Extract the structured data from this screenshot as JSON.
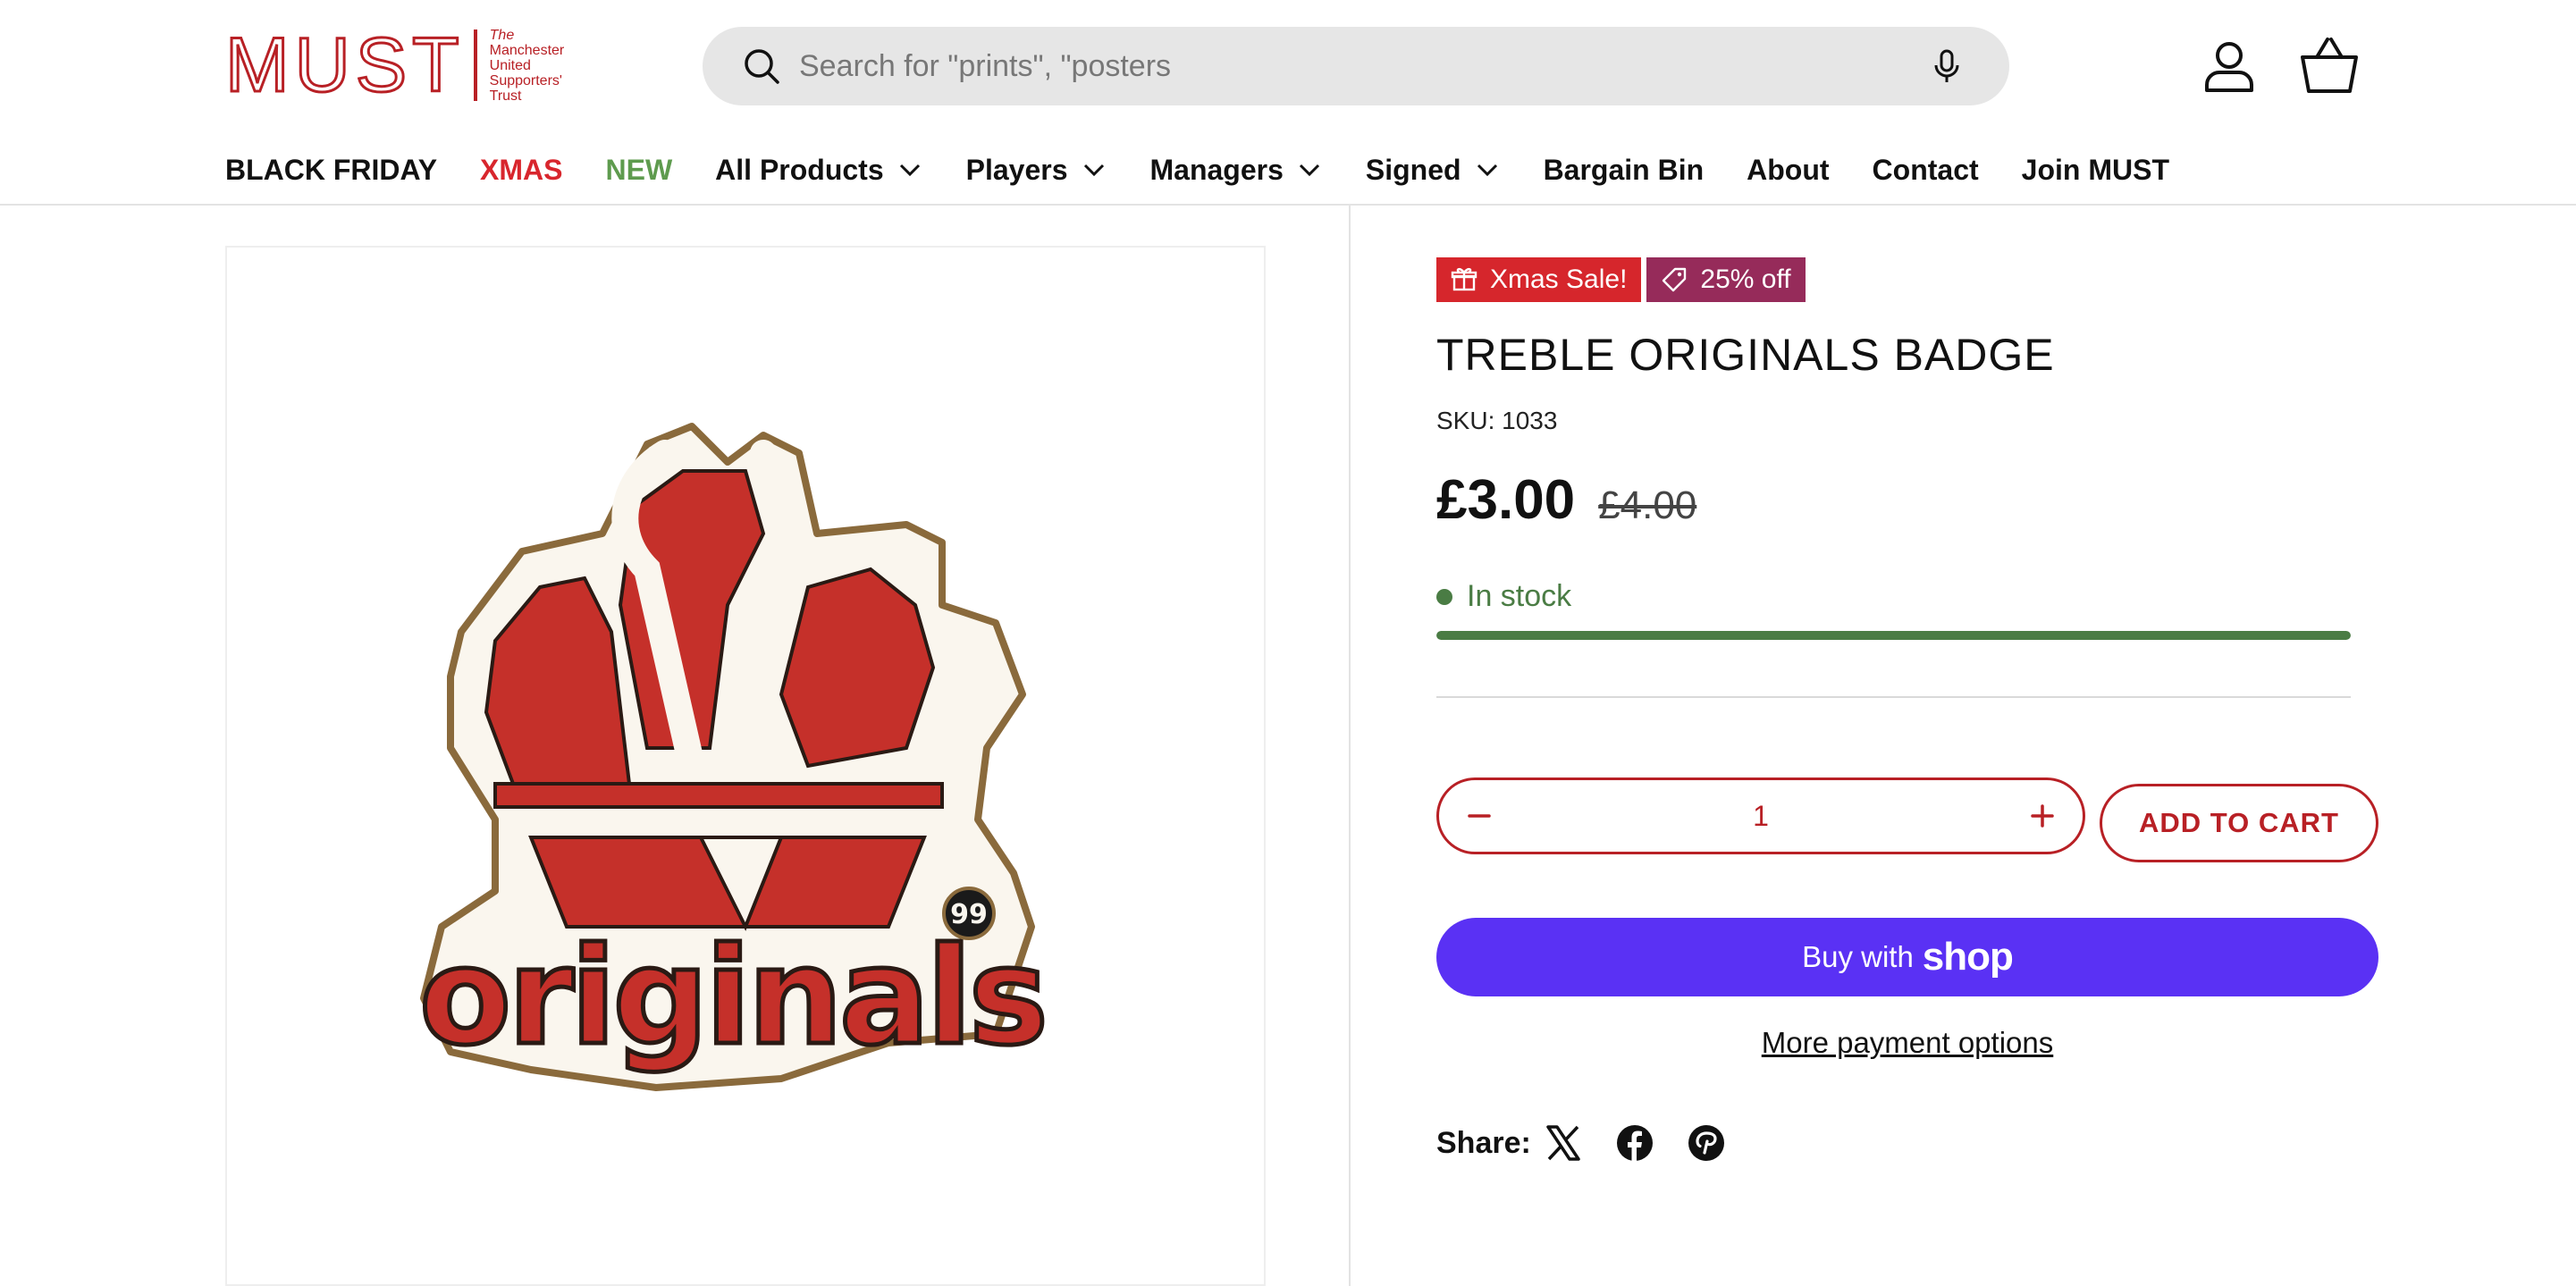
{
  "logo": {
    "word": "MUST",
    "lines": [
      "The",
      "Manchester",
      "United",
      "Supporters'",
      "Trust"
    ]
  },
  "search": {
    "placeholder": "Search for \"prints\", \"posters"
  },
  "nav": [
    {
      "label": "BLACK FRIDAY"
    },
    {
      "label": "XMAS"
    },
    {
      "label": "NEW"
    },
    {
      "label": "All Products"
    },
    {
      "label": "Players"
    },
    {
      "label": "Managers"
    },
    {
      "label": "Signed"
    },
    {
      "label": "Bargain Bin"
    },
    {
      "label": "About"
    },
    {
      "label": "Contact"
    },
    {
      "label": "Join MUST"
    }
  ],
  "product": {
    "badges": {
      "sale": "Xmas Sale!",
      "off": "25% off"
    },
    "title": "TREBLE ORIGINALS BADGE",
    "sku": "SKU: 1033",
    "price": "£3.00",
    "compare_price": "£4.00",
    "stock_text": "In stock",
    "stock_level": 1.0,
    "image_text": "originals",
    "image_badge_text": "99"
  },
  "purchase": {
    "quantity": "1",
    "add_to_cart": "ADD TO CART",
    "buy_with": "Buy with",
    "shop_brand": "shop",
    "more_options": "More payment options"
  },
  "share": {
    "label": "Share:"
  },
  "colors": {
    "brand_red": "#b82025",
    "sale_red": "#d6262c",
    "discount_purple": "#962b5a",
    "stock_green": "#4a7c44",
    "shop_pay": "#5a31f4",
    "xmas_red": "#d8262d",
    "new_green": "#5e9b4e"
  }
}
